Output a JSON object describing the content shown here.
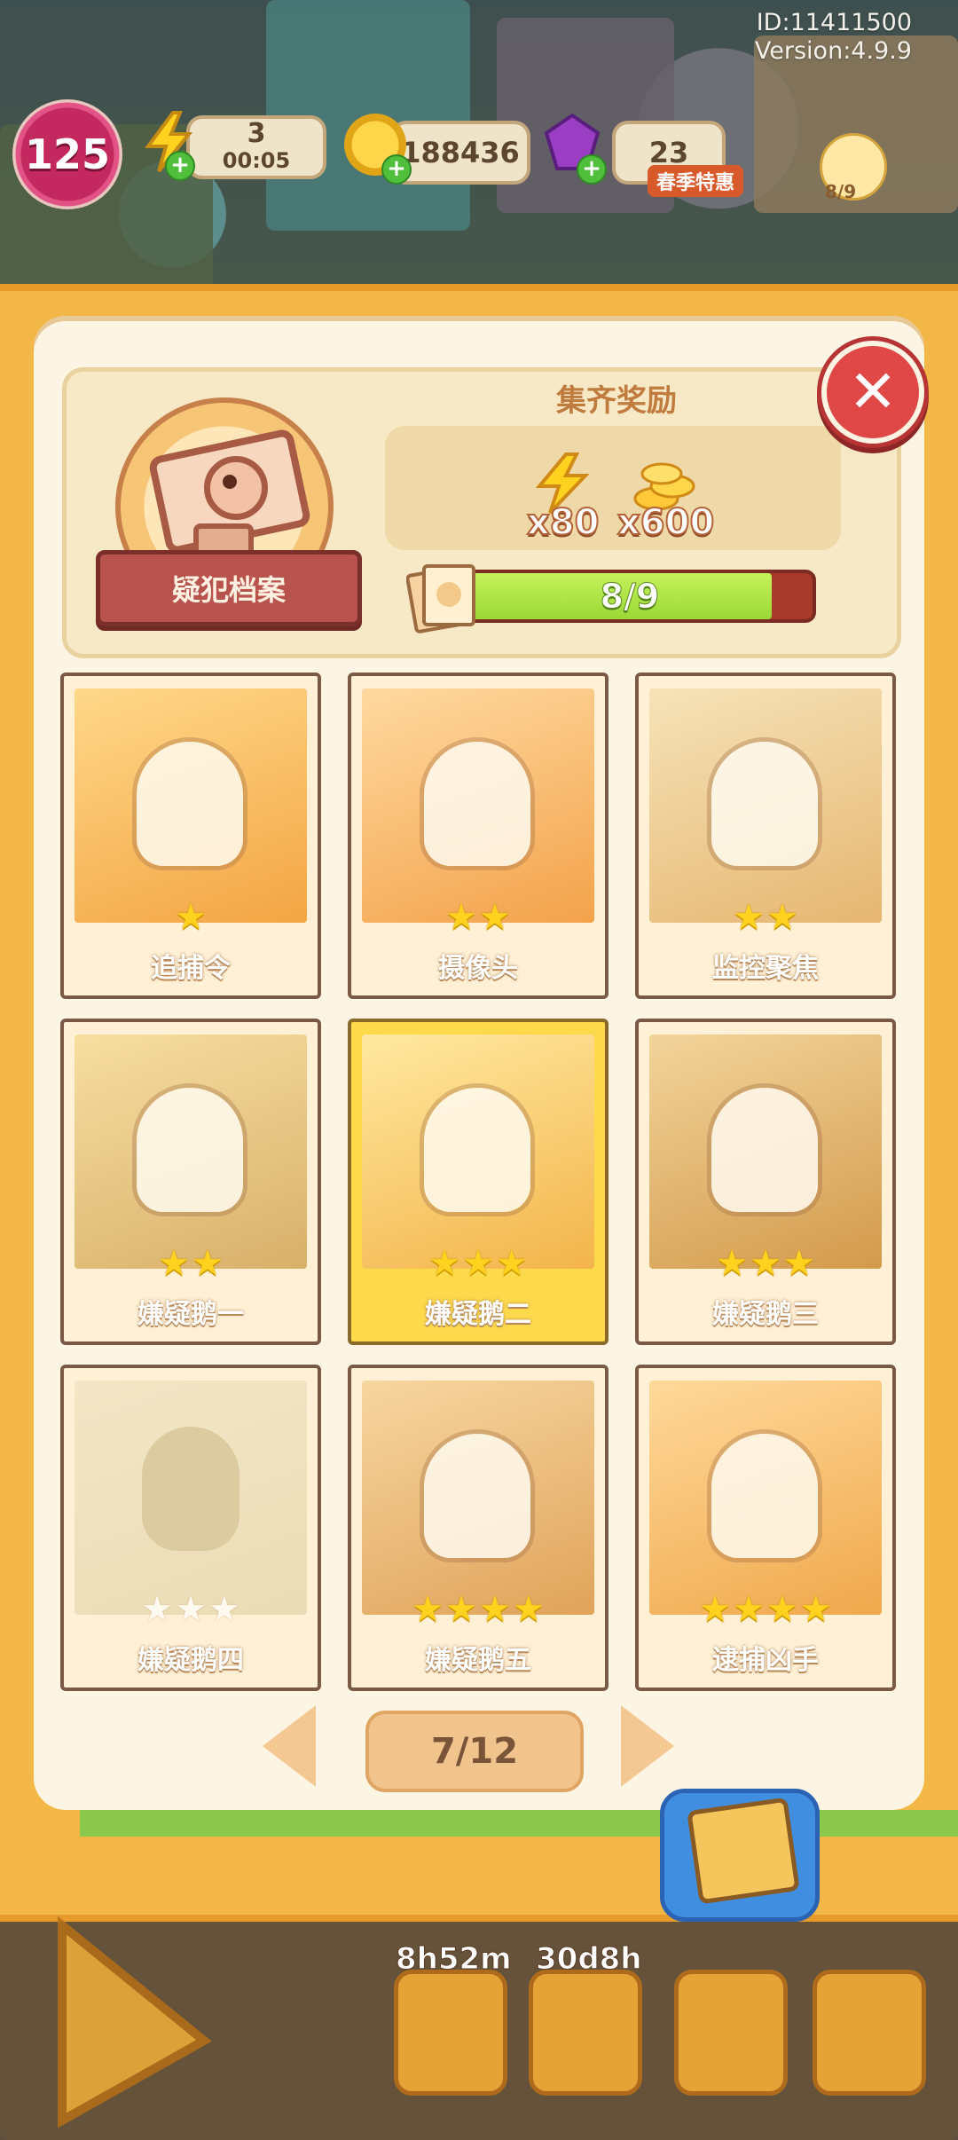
{
  "meta": {
    "id": "ID:11411500",
    "version": "Version:4.9.9"
  },
  "hud": {
    "level": "125",
    "energy": "3",
    "energy_timer": "00:05",
    "coins": "188436",
    "gems": "23",
    "event_label": "春季特惠",
    "event_count": "8/9"
  },
  "collection": {
    "title": "疑犯档案",
    "reward_title": "集齐奖励",
    "rewards": [
      {
        "icon": "energy-bolt-icon",
        "amount": "x80"
      },
      {
        "icon": "coin-stack-icon",
        "amount": "x600"
      }
    ],
    "progress_text": "8/9",
    "progress_fraction": 0.888
  },
  "cards": [
    {
      "name": "追捕令",
      "stars": 1,
      "max_stars": 1,
      "owned": true,
      "highlight": false
    },
    {
      "name": "摄像头",
      "stars": 2,
      "max_stars": 2,
      "owned": true,
      "highlight": false
    },
    {
      "name": "监控聚焦",
      "stars": 2,
      "max_stars": 2,
      "owned": true,
      "highlight": false
    },
    {
      "name": "嫌疑鹅一",
      "stars": 2,
      "max_stars": 2,
      "owned": true,
      "highlight": false
    },
    {
      "name": "嫌疑鹅二",
      "stars": 3,
      "max_stars": 3,
      "owned": true,
      "highlight": true
    },
    {
      "name": "嫌疑鹅三",
      "stars": 3,
      "max_stars": 3,
      "owned": true,
      "highlight": false
    },
    {
      "name": "嫌疑鹅四",
      "stars": 0,
      "max_stars": 3,
      "owned": false,
      "highlight": false
    },
    {
      "name": "嫌疑鹅五",
      "stars": 4,
      "max_stars": 4,
      "owned": true,
      "highlight": false
    },
    {
      "name": "逮捕凶手",
      "stars": 4,
      "max_stars": 4,
      "owned": true,
      "highlight": false
    }
  ],
  "pager": {
    "label": "7/12"
  },
  "bottom": {
    "timer_left": "8h52m",
    "timer_right": "30d8h"
  },
  "colors": {
    "accent": "#f2b746",
    "close": "#e04848",
    "progress": "#9ad836",
    "star": "#ffd21f"
  }
}
